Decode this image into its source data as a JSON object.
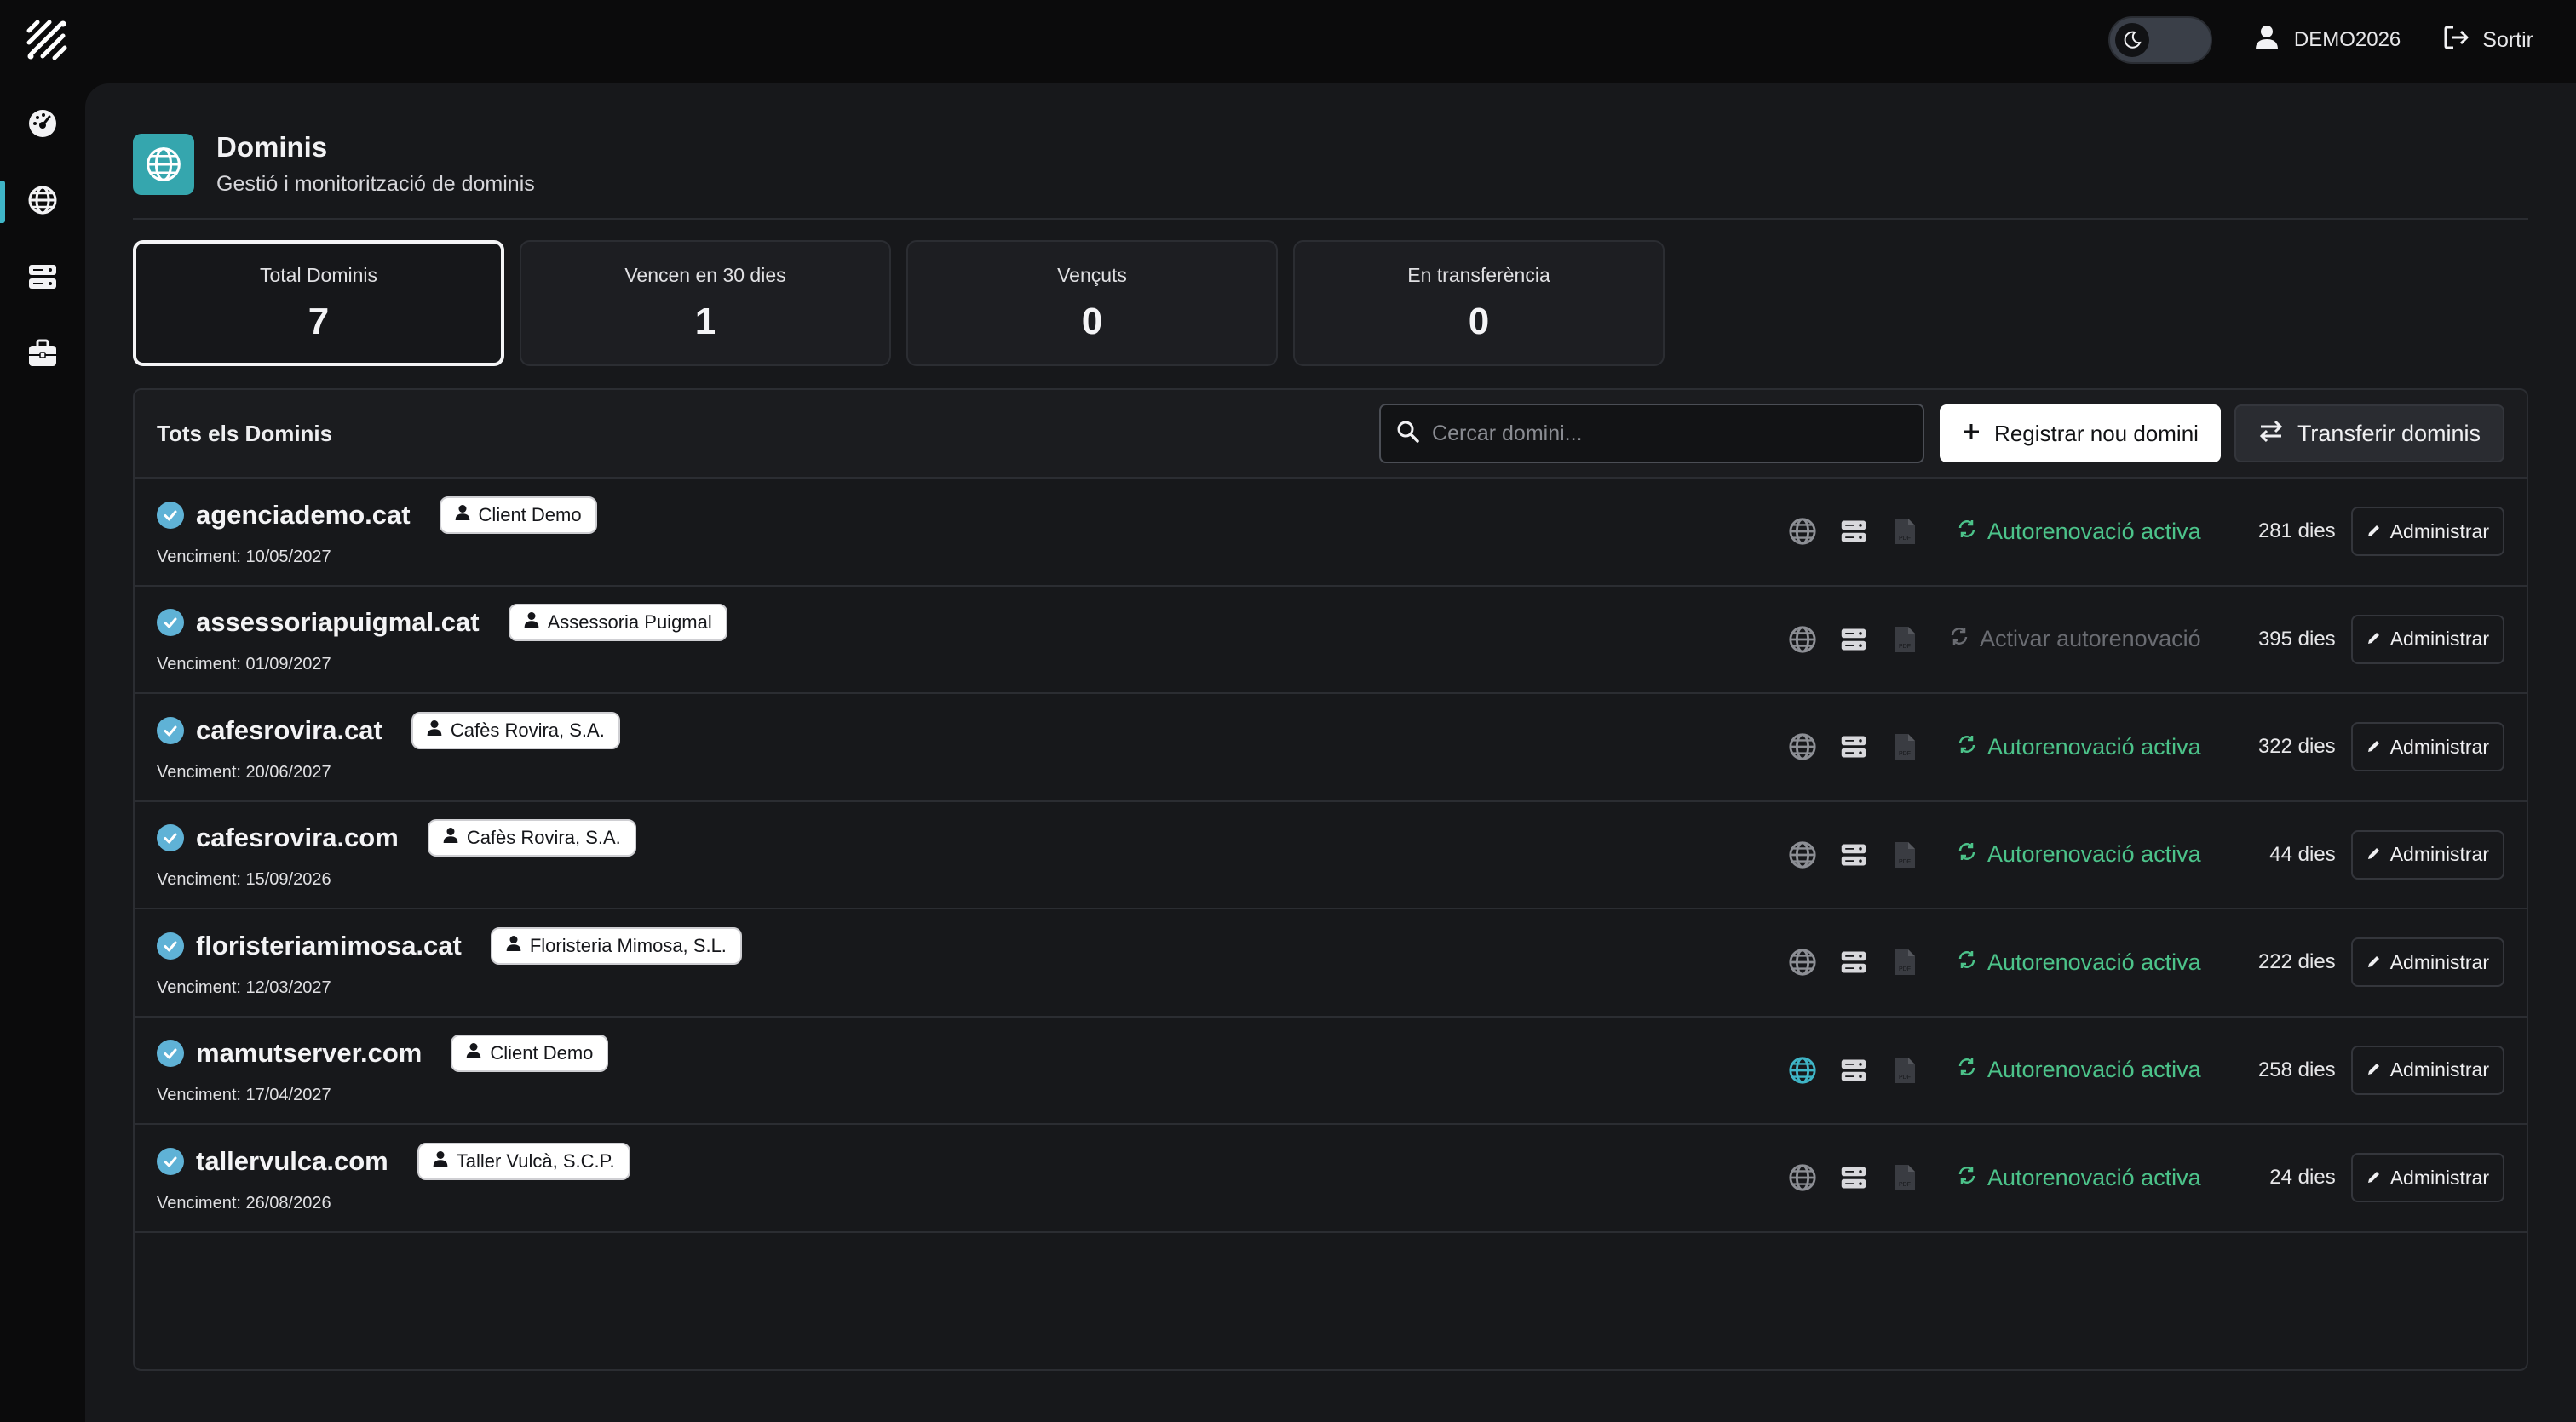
{
  "colors": {
    "accent": "#3fb5c7",
    "renew_active": "#4cc38a",
    "renew_inactive": "#6a6c72",
    "dns_active": "#3fb5c7"
  },
  "topbar": {
    "username": "DEMO2026",
    "logout_label": "Sortir"
  },
  "sidebar": {
    "items": [
      {
        "icon": "dashboard-gauge-icon"
      },
      {
        "icon": "globe-icon",
        "active": true
      },
      {
        "icon": "server-icon"
      },
      {
        "icon": "briefcase-icon"
      }
    ]
  },
  "header": {
    "title": "Dominis",
    "subtitle": "Gestió i monitorització de dominis"
  },
  "stats": [
    {
      "label": "Total Dominis",
      "value": "7"
    },
    {
      "label": "Vencen en 30 dies",
      "value": "1"
    },
    {
      "label": "Vençuts",
      "value": "0"
    },
    {
      "label": "En transferència",
      "value": "0"
    }
  ],
  "table": {
    "title": "Tots els Dominis",
    "search_placeholder": "Cercar domini...",
    "register_label": "Registrar nou domini",
    "transfer_label": "Transferir dominis",
    "admin_label": "Administrar",
    "rows": [
      {
        "domain": "agenciademo.cat",
        "client": "Client Demo",
        "expiry": "Venciment: 10/05/2027",
        "renew": "Autorenovació activa",
        "renew_active": true,
        "days": "281 dies",
        "dns_active": false
      },
      {
        "domain": "assessoriapuigmal.cat",
        "client": "Assessoria Puigmal",
        "expiry": "Venciment: 01/09/2027",
        "renew": "Activar autorenovació",
        "renew_active": false,
        "days": "395 dies",
        "dns_active": false
      },
      {
        "domain": "cafesrovira.cat",
        "client": "Cafès Rovira, S.A.",
        "expiry": "Venciment: 20/06/2027",
        "renew": "Autorenovació activa",
        "renew_active": true,
        "days": "322 dies",
        "dns_active": false
      },
      {
        "domain": "cafesrovira.com",
        "client": "Cafès Rovira, S.A.",
        "expiry": "Venciment: 15/09/2026",
        "renew": "Autorenovació activa",
        "renew_active": true,
        "days": "44 dies",
        "dns_active": false
      },
      {
        "domain": "floristeriamimosa.cat",
        "client": "Floristeria Mimosa, S.L.",
        "expiry": "Venciment: 12/03/2027",
        "renew": "Autorenovació activa",
        "renew_active": true,
        "days": "222 dies",
        "dns_active": false
      },
      {
        "domain": "mamutserver.com",
        "client": "Client Demo",
        "expiry": "Venciment: 17/04/2027",
        "renew": "Autorenovació activa",
        "renew_active": true,
        "days": "258 dies",
        "dns_active": true
      },
      {
        "domain": "tallervulca.com",
        "client": "Taller Vulcà, S.C.P.",
        "expiry": "Venciment: 26/08/2026",
        "renew": "Autorenovació activa",
        "renew_active": true,
        "days": "24 dies",
        "dns_active": false
      }
    ]
  }
}
